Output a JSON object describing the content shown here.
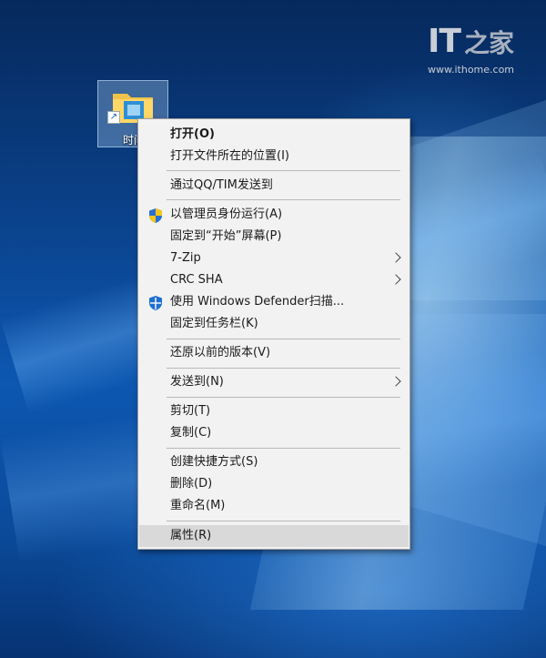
{
  "watermark": {
    "logo": "IT",
    "logo_sub": "之家",
    "url": "www.ithome.com"
  },
  "desktop_icon": {
    "label": "时间"
  },
  "context_menu": {
    "items": [
      {
        "label": "打开(O)"
      },
      {
        "label": "打开文件所在的位置(I)"
      },
      {
        "label": "通过QQ/TIM发送到"
      },
      {
        "label": "以管理员身份运行(A)",
        "icon": "uac-shield-icon"
      },
      {
        "label": "固定到“开始”屏幕(P)"
      },
      {
        "label": "7-Zip",
        "submenu": true
      },
      {
        "label": "CRC SHA",
        "submenu": true
      },
      {
        "label": "使用 Windows Defender扫描...",
        "icon": "windows-defender-icon"
      },
      {
        "label": "固定到任务栏(K)"
      },
      {
        "label": "还原以前的版本(V)"
      },
      {
        "label": "发送到(N)",
        "submenu": true
      },
      {
        "label": "剪切(T)"
      },
      {
        "label": "复制(C)"
      },
      {
        "label": "创建快捷方式(S)"
      },
      {
        "label": "删除(D)"
      },
      {
        "label": "重命名(M)"
      },
      {
        "label": "属性(R)",
        "highlighted": true
      }
    ]
  },
  "colors": {
    "menu_bg": "#f2f2f2",
    "menu_hover": "#d9d9d9",
    "menu_border": "#a0a0a0",
    "desktop_blue": "#0d57b1"
  }
}
